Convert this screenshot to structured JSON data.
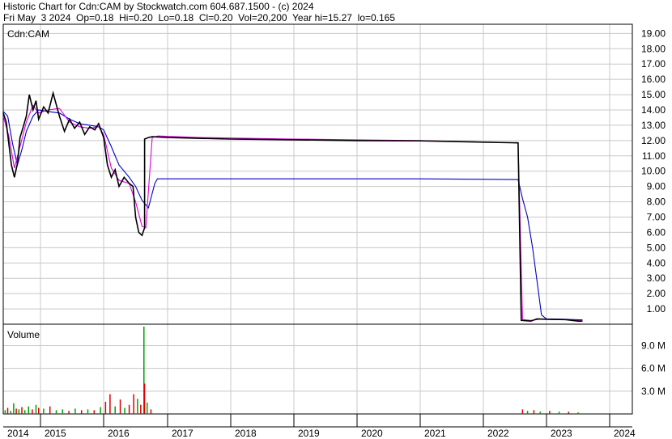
{
  "header": {
    "title": "Historic Chart for Cdn:CAM by Stockwatch.com 604.687.1500 - (c) 2024",
    "stats": "Fri May  3 2024  Op=0.18  Hi=0.20  Lo=0.18  Cl=0.20  Vol=20,200  Year hi=15.27  lo=0.165"
  },
  "colors": {
    "price": "#000000",
    "ma_short": "#e000e0",
    "ma_long": "#0000c0",
    "volume_up": "#00a000",
    "volume_down": "#e00000",
    "grid": "#c8c8c8"
  },
  "chart_data": [
    {
      "type": "line",
      "title": "",
      "symbol_label": "Cdn:CAM",
      "x_ticks": [
        "2014",
        "2015",
        "2016",
        "2017",
        "2018",
        "2019",
        "2020",
        "2021",
        "2022",
        "2023",
        "2024"
      ],
      "y_ticks": [
        "1.00",
        "2.00",
        "3.00",
        "4.00",
        "5.00",
        "6.00",
        "7.00",
        "8.00",
        "9.00",
        "10.00",
        "11.00",
        "12.00",
        "13.00",
        "14.00",
        "15.00",
        "16.00",
        "17.00",
        "18.00",
        "19.00"
      ],
      "ylim": [
        0,
        19.6
      ],
      "grid": true,
      "series": [
        {
          "key": "price",
          "values": [
            [
              2014.0,
              13.8
            ],
            [
              2014.08,
              13.2
            ],
            [
              2014.15,
              11.8
            ],
            [
              2014.22,
              10.4
            ],
            [
              2014.3,
              9.6
            ],
            [
              2014.38,
              10.5
            ],
            [
              2014.45,
              12.2
            ],
            [
              2014.55,
              13.0
            ],
            [
              2014.62,
              13.6
            ],
            [
              2014.7,
              15.0
            ],
            [
              2014.8,
              14.0
            ],
            [
              2014.88,
              14.6
            ],
            [
              2014.95,
              13.4
            ],
            [
              2015.05,
              14.2
            ],
            [
              2015.12,
              13.8
            ],
            [
              2015.2,
              15.1
            ],
            [
              2015.3,
              13.6
            ],
            [
              2015.38,
              12.6
            ],
            [
              2015.46,
              13.4
            ],
            [
              2015.54,
              12.8
            ],
            [
              2015.62,
              13.2
            ],
            [
              2015.7,
              12.4
            ],
            [
              2015.78,
              12.9
            ],
            [
              2015.86,
              12.7
            ],
            [
              2015.92,
              13.1
            ],
            [
              2016.0,
              12.2
            ],
            [
              2016.06,
              10.4
            ],
            [
              2016.12,
              9.6
            ],
            [
              2016.18,
              10.1
            ],
            [
              2016.24,
              9.0
            ],
            [
              2016.32,
              9.6
            ],
            [
              2016.4,
              9.2
            ],
            [
              2016.46,
              9.0
            ],
            [
              2016.5,
              7.0
            ],
            [
              2016.55,
              6.0
            ],
            [
              2016.6,
              5.8
            ],
            [
              2016.64,
              6.3
            ],
            [
              2016.64,
              12.1
            ],
            [
              2016.7,
              12.2
            ],
            [
              2016.76,
              12.25
            ],
            [
              2017.0,
              12.2
            ],
            [
              2018.0,
              12.1
            ],
            [
              2019.0,
              12.05
            ],
            [
              2020.0,
              12.0
            ],
            [
              2021.0,
              11.98
            ],
            [
              2022.0,
              11.9
            ],
            [
              2022.55,
              11.85
            ],
            [
              2022.6,
              0.25
            ],
            [
              2022.75,
              0.2
            ],
            [
              2022.85,
              0.35
            ],
            [
              2023.0,
              0.32
            ],
            [
              2023.3,
              0.3
            ],
            [
              2023.5,
              0.2
            ],
            [
              2023.57,
              0.2
            ]
          ]
        },
        {
          "key": "ma_short",
          "values": [
            [
              2014.0,
              13.6
            ],
            [
              2014.15,
              12.3
            ],
            [
              2014.3,
              10.2
            ],
            [
              2014.45,
              11.6
            ],
            [
              2014.62,
              13.2
            ],
            [
              2014.8,
              14.3
            ],
            [
              2014.95,
              13.8
            ],
            [
              2015.12,
              14.0
            ],
            [
              2015.3,
              14.1
            ],
            [
              2015.46,
              13.2
            ],
            [
              2015.62,
              12.9
            ],
            [
              2015.78,
              12.8
            ],
            [
              2015.92,
              12.9
            ],
            [
              2016.0,
              12.4
            ],
            [
              2016.12,
              10.2
            ],
            [
              2016.24,
              9.4
            ],
            [
              2016.4,
              9.2
            ],
            [
              2016.5,
              8.0
            ],
            [
              2016.6,
              6.4
            ],
            [
              2016.66,
              6.3
            ],
            [
              2016.76,
              12.2
            ],
            [
              2016.85,
              12.3
            ],
            [
              2017.5,
              12.2
            ],
            [
              2019.0,
              12.1
            ],
            [
              2021.0,
              12.0
            ],
            [
              2022.55,
              11.85
            ],
            [
              2022.62,
              0.3
            ],
            [
              2022.75,
              0.25
            ],
            [
              2022.9,
              0.33
            ],
            [
              2023.3,
              0.3
            ],
            [
              2023.57,
              0.22
            ]
          ]
        },
        {
          "key": "ma_long",
          "values": [
            [
              2014.0,
              13.9
            ],
            [
              2014.12,
              13.6
            ],
            [
              2014.25,
              11.8
            ],
            [
              2014.38,
              10.4
            ],
            [
              2014.5,
              11.4
            ],
            [
              2014.62,
              12.6
            ],
            [
              2014.8,
              13.6
            ],
            [
              2014.95,
              14.0
            ],
            [
              2015.12,
              13.9
            ],
            [
              2015.3,
              13.8
            ],
            [
              2015.46,
              13.4
            ],
            [
              2015.62,
              13.1
            ],
            [
              2015.78,
              13.0
            ],
            [
              2015.92,
              12.9
            ],
            [
              2016.0,
              12.7
            ],
            [
              2016.12,
              11.6
            ],
            [
              2016.24,
              10.4
            ],
            [
              2016.4,
              9.6
            ],
            [
              2016.5,
              9.0
            ],
            [
              2016.6,
              8.1
            ],
            [
              2016.7,
              7.6
            ],
            [
              2016.8,
              9.2
            ],
            [
              2016.84,
              9.5
            ],
            [
              2017.5,
              9.5
            ],
            [
              2019.0,
              9.5
            ],
            [
              2021.0,
              9.5
            ],
            [
              2022.55,
              9.45
            ],
            [
              2022.62,
              8.2
            ],
            [
              2022.7,
              7.0
            ],
            [
              2022.78,
              5.0
            ],
            [
              2022.86,
              2.5
            ],
            [
              2022.92,
              0.6
            ],
            [
              2023.0,
              0.35
            ],
            [
              2023.3,
              0.32
            ],
            [
              2023.57,
              0.28
            ]
          ]
        }
      ]
    },
    {
      "type": "bar",
      "title": "Volume",
      "y_ticks": [
        "3.0 M",
        "6.0 M",
        "9.0 M"
      ],
      "ylim": [
        0,
        11.5
      ],
      "grid": true,
      "spikes": [
        {
          "x": 2014.05,
          "value": 0.5,
          "up": true
        },
        {
          "x": 2014.12,
          "value": 0.8,
          "up": false
        },
        {
          "x": 2014.2,
          "value": 0.4,
          "up": true
        },
        {
          "x": 2014.28,
          "value": 1.4,
          "up": true
        },
        {
          "x": 2014.35,
          "value": 0.7,
          "up": false
        },
        {
          "x": 2014.42,
          "value": 0.6,
          "up": true
        },
        {
          "x": 2014.5,
          "value": 0.9,
          "up": false
        },
        {
          "x": 2014.58,
          "value": 0.5,
          "up": true
        },
        {
          "x": 2014.68,
          "value": 1.0,
          "up": true
        },
        {
          "x": 2014.78,
          "value": 0.6,
          "up": false
        },
        {
          "x": 2014.88,
          "value": 1.2,
          "up": true
        },
        {
          "x": 2014.95,
          "value": 0.8,
          "up": false
        },
        {
          "x": 2015.05,
          "value": 0.7,
          "up": true
        },
        {
          "x": 2015.15,
          "value": 1.0,
          "up": false
        },
        {
          "x": 2015.25,
          "value": 0.5,
          "up": true
        },
        {
          "x": 2015.35,
          "value": 0.6,
          "up": true
        },
        {
          "x": 2015.45,
          "value": 0.4,
          "up": false
        },
        {
          "x": 2015.55,
          "value": 0.7,
          "up": true
        },
        {
          "x": 2015.65,
          "value": 0.5,
          "up": false
        },
        {
          "x": 2015.75,
          "value": 0.6,
          "up": true
        },
        {
          "x": 2015.85,
          "value": 0.5,
          "up": false
        },
        {
          "x": 2015.95,
          "value": 0.9,
          "up": true
        },
        {
          "x": 2016.03,
          "value": 1.6,
          "up": false
        },
        {
          "x": 2016.1,
          "value": 2.6,
          "up": false
        },
        {
          "x": 2016.18,
          "value": 1.0,
          "up": true
        },
        {
          "x": 2016.26,
          "value": 1.9,
          "up": false
        },
        {
          "x": 2016.33,
          "value": 0.8,
          "up": true
        },
        {
          "x": 2016.4,
          "value": 1.2,
          "up": false
        },
        {
          "x": 2016.47,
          "value": 2.6,
          "up": false
        },
        {
          "x": 2016.53,
          "value": 2.0,
          "up": true
        },
        {
          "x": 2016.58,
          "value": 1.2,
          "up": false
        },
        {
          "x": 2016.63,
          "value": 11.5,
          "up": true
        },
        {
          "x": 2016.64,
          "value": 4.0,
          "up": false
        },
        {
          "x": 2016.68,
          "value": 1.5,
          "up": true
        },
        {
          "x": 2016.74,
          "value": 0.6,
          "up": false
        },
        {
          "x": 2022.62,
          "value": 0.6,
          "up": false
        },
        {
          "x": 2022.7,
          "value": 0.4,
          "up": true
        },
        {
          "x": 2022.8,
          "value": 0.5,
          "up": false
        },
        {
          "x": 2022.9,
          "value": 0.3,
          "up": true
        },
        {
          "x": 2023.05,
          "value": 0.4,
          "up": false
        },
        {
          "x": 2023.2,
          "value": 0.3,
          "up": true
        },
        {
          "x": 2023.35,
          "value": 0.3,
          "up": false
        },
        {
          "x": 2023.5,
          "value": 0.2,
          "up": true
        }
      ]
    }
  ]
}
